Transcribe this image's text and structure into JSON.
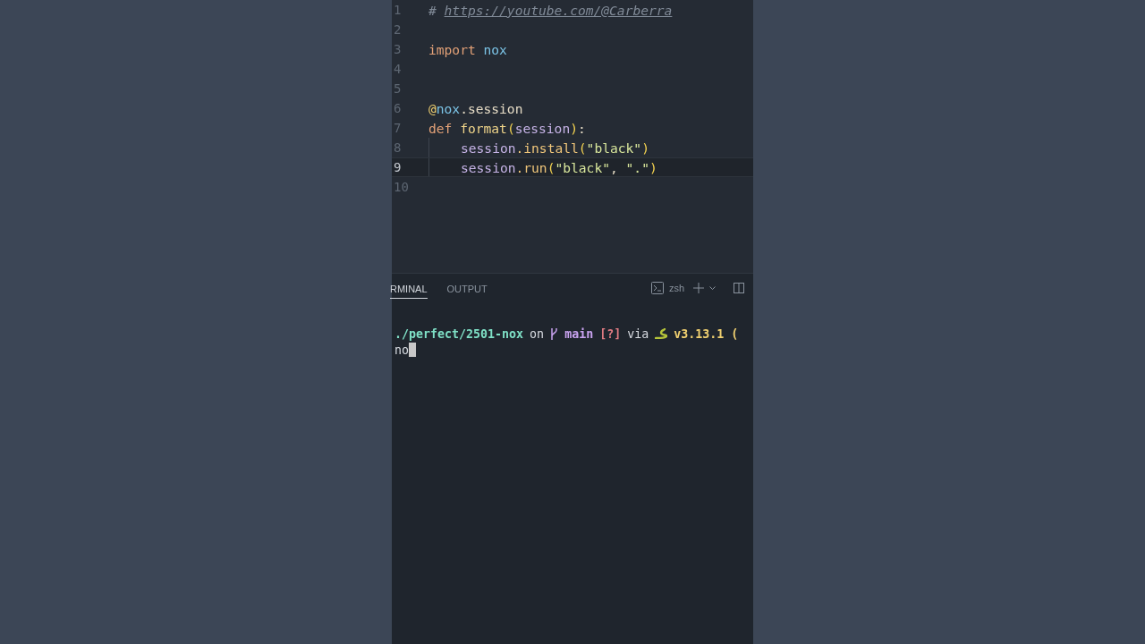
{
  "editor": {
    "lines": [
      {
        "number": "1",
        "current": false,
        "indent": false,
        "tokens": [
          {
            "kind": "comment",
            "text": "# "
          },
          {
            "kind": "link",
            "text": "https://youtube.com/@Carberra"
          }
        ]
      },
      {
        "number": "2",
        "current": false,
        "indent": false
      },
      {
        "number": "3",
        "current": false,
        "indent": false,
        "tokens": [
          {
            "kind": "keyword",
            "text": "import"
          },
          {
            "kind": "module",
            "text": " nox"
          }
        ]
      },
      {
        "number": "4",
        "current": false,
        "indent": false
      },
      {
        "number": "5",
        "current": false,
        "indent": false
      },
      {
        "number": "6",
        "current": false,
        "indent": false,
        "tokens": [
          {
            "kind": "decorator",
            "text": "@"
          },
          {
            "kind": "module",
            "text": "nox"
          },
          {
            "kind": "attr",
            "text": ".session"
          }
        ]
      },
      {
        "number": "7",
        "current": false,
        "indent": false,
        "tokens": [
          {
            "kind": "keyword",
            "text": "def"
          },
          {
            "kind": "func",
            "text": " format"
          },
          {
            "kind": "paren",
            "text": "("
          },
          {
            "kind": "param",
            "text": "session"
          },
          {
            "kind": "paren",
            "text": ")"
          },
          {
            "kind": "attr",
            "text": ":"
          }
        ]
      },
      {
        "number": "8",
        "current": false,
        "indent": true,
        "tokens": [
          {
            "kind": "param",
            "text": "session"
          },
          {
            "kind": "method",
            "text": ".install"
          },
          {
            "kind": "paren",
            "text": "("
          },
          {
            "kind": "string",
            "text": "\"black\""
          },
          {
            "kind": "paren",
            "text": ")"
          }
        ]
      },
      {
        "number": "9",
        "current": true,
        "indent": true,
        "tokens": [
          {
            "kind": "param",
            "text": "session"
          },
          {
            "kind": "method",
            "text": ".run"
          },
          {
            "kind": "paren",
            "text": "("
          },
          {
            "kind": "string",
            "text": "\"black\""
          },
          {
            "kind": "attr",
            "text": ", "
          },
          {
            "kind": "string",
            "text": "\".\""
          },
          {
            "kind": "paren",
            "text": ")"
          }
        ]
      },
      {
        "number": "10",
        "current": false,
        "indent": false
      }
    ]
  },
  "panel": {
    "tabs": [
      {
        "label": "RMINAL",
        "selected": true
      },
      {
        "label": "OUTPUT",
        "selected": false
      }
    ],
    "shell": "zsh"
  },
  "terminal": {
    "prompt": {
      "path": "./perfect/2501-nox",
      "on": "on",
      "branch": "main",
      "status": "[?]",
      "via": "via",
      "version": "v3.13.1",
      "tail": "("
    },
    "input": "no"
  }
}
